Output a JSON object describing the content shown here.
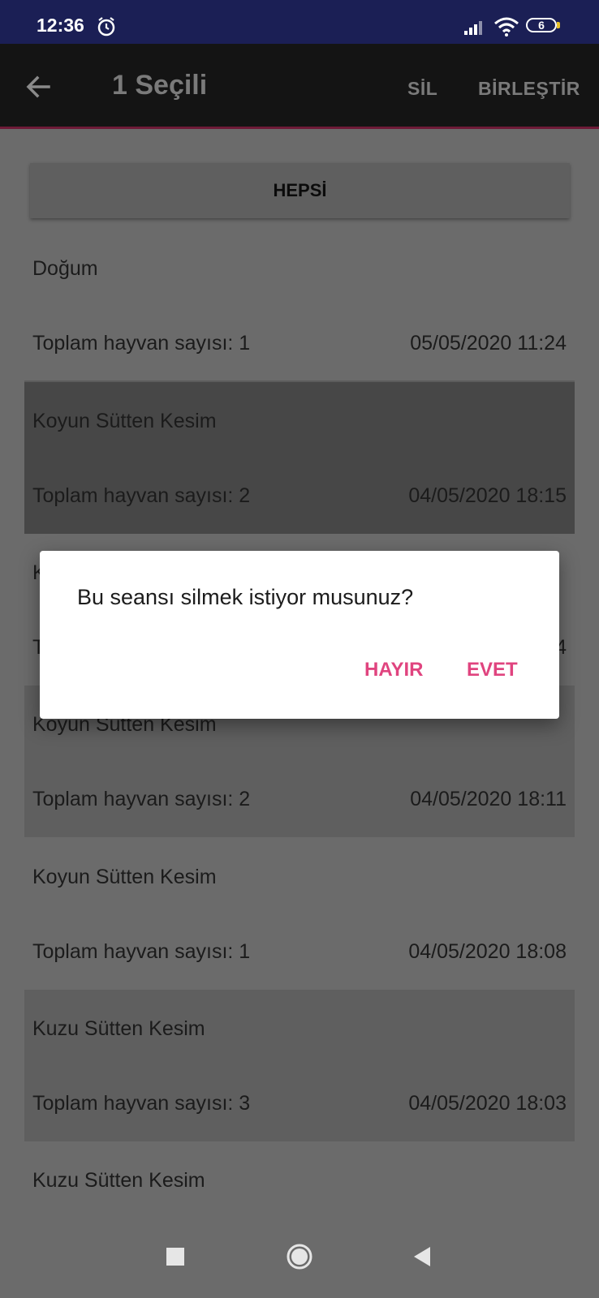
{
  "status_bar": {
    "time": "12:36",
    "battery": "6"
  },
  "app_bar": {
    "title": "1 Seçili",
    "actions": {
      "delete": "SİL",
      "merge": "BİRLEŞTİR"
    }
  },
  "filter_button": "HEPSİ",
  "sessions": [
    {
      "title": "Doğum",
      "count": "Toplam hayvan sayısı: 1",
      "date": "05/05/2020 11:24",
      "selected": false
    },
    {
      "title": "Koyun Sütten Kesim",
      "count": "Toplam hayvan sayısı: 2",
      "date": "04/05/2020 18:15",
      "selected": true
    },
    {
      "title": "K",
      "count": "T",
      "date": "4",
      "selected": false
    },
    {
      "title": "Koyun Sütten Kesim",
      "count": "Toplam hayvan sayısı: 2",
      "date": "04/05/2020 18:11",
      "selected": false
    },
    {
      "title": "Koyun Sütten Kesim",
      "count": "Toplam hayvan sayısı: 1",
      "date": "04/05/2020 18:08",
      "selected": false
    },
    {
      "title": "Kuzu Sütten Kesim",
      "count": "Toplam hayvan sayısı: 3",
      "date": "04/05/2020 18:03",
      "selected": false
    },
    {
      "title": "Kuzu Sütten Kesim"
    }
  ],
  "dialog": {
    "message": "Bu seansı silmek istiyor musunuz?",
    "negative": "HAYIR",
    "positive": "EVET"
  },
  "colors": {
    "accent": "#e0447f",
    "status_bar": "#1b1f55",
    "app_bar": "#141414"
  }
}
